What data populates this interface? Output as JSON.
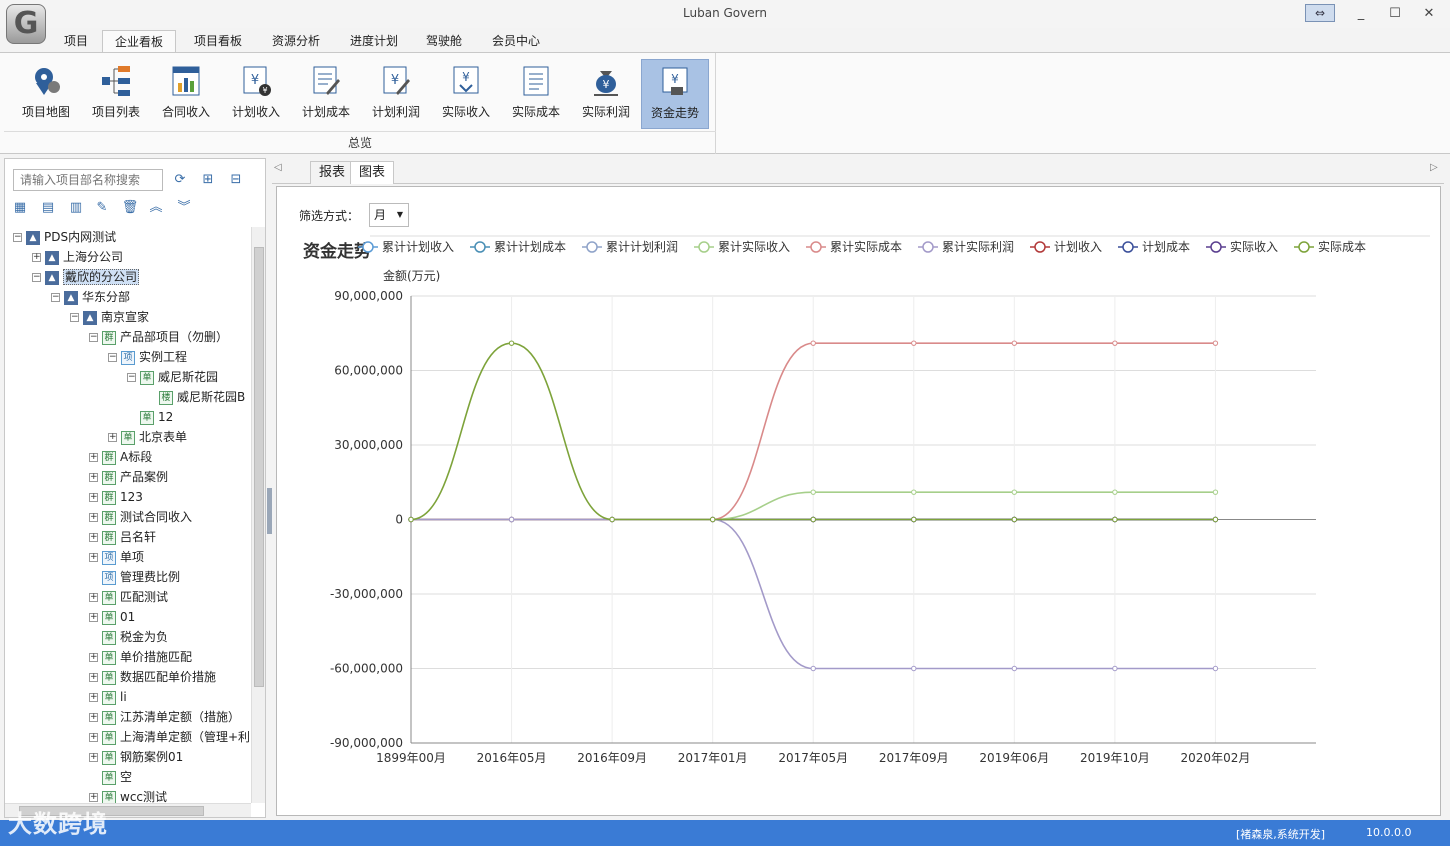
{
  "window": {
    "title": "Luban Govern",
    "logo_glyph": "G",
    "restore_glyph": "⇔",
    "minimize": "_",
    "maximize": "☐",
    "close": "✕"
  },
  "menu": {
    "tabs": [
      "项目",
      "企业看板",
      "项目看板",
      "资源分析",
      "进度计划",
      "驾驶舱",
      "会员中心"
    ],
    "active": "企业看板"
  },
  "ribbon": {
    "buttons": [
      "项目地图",
      "项目列表",
      "合同收入",
      "计划收入",
      "计划成本",
      "计划利润",
      "实际收入",
      "实际成本",
      "实际利润",
      "资金走势"
    ],
    "active": "资金走势",
    "group_label": "总览"
  },
  "sidebar": {
    "search_placeholder": "请输入项目部名称搜索",
    "tree": [
      {
        "label": "PDS内网测试",
        "level": 0,
        "exp": "−",
        "icon": "org"
      },
      {
        "label": "上海分公司",
        "level": 1,
        "exp": "+",
        "icon": "org"
      },
      {
        "label": "戴欣的分公司",
        "level": 1,
        "exp": "−",
        "icon": "org",
        "selected": true
      },
      {
        "label": "华东分部",
        "level": 2,
        "exp": "−",
        "icon": "org"
      },
      {
        "label": "南京宣家",
        "level": 3,
        "exp": "−",
        "icon": "org"
      },
      {
        "label": "产品部项目（勿删）",
        "level": 4,
        "exp": "−",
        "icon": "群"
      },
      {
        "label": "实例工程",
        "level": 5,
        "exp": "−",
        "icon": "项"
      },
      {
        "label": "威尼斯花园",
        "level": 6,
        "exp": "−",
        "icon": "单"
      },
      {
        "label": "威尼斯花园B",
        "level": 7,
        "exp": "",
        "icon": "楼"
      },
      {
        "label": "12",
        "level": 6,
        "exp": "",
        "icon": "单"
      },
      {
        "label": "北京表单",
        "level": 5,
        "exp": "+",
        "icon": "单"
      },
      {
        "label": "A标段",
        "level": 4,
        "exp": "+",
        "icon": "群"
      },
      {
        "label": "产品案例",
        "level": 4,
        "exp": "+",
        "icon": "群"
      },
      {
        "label": "123",
        "level": 4,
        "exp": "+",
        "icon": "群"
      },
      {
        "label": "测试合同收入",
        "level": 4,
        "exp": "+",
        "icon": "群"
      },
      {
        "label": "吕名轩",
        "level": 4,
        "exp": "+",
        "icon": "群"
      },
      {
        "label": "单项",
        "level": 4,
        "exp": "+",
        "icon": "项"
      },
      {
        "label": "管理费比例",
        "level": 4,
        "exp": "",
        "icon": "项"
      },
      {
        "label": "匹配测试",
        "level": 4,
        "exp": "+",
        "icon": "单"
      },
      {
        "label": "01",
        "level": 4,
        "exp": "+",
        "icon": "单"
      },
      {
        "label": "税金为负",
        "level": 4,
        "exp": "",
        "icon": "单"
      },
      {
        "label": "单价措施匹配",
        "level": 4,
        "exp": "+",
        "icon": "单"
      },
      {
        "label": "数据匹配单价措施",
        "level": 4,
        "exp": "+",
        "icon": "单"
      },
      {
        "label": "li",
        "level": 4,
        "exp": "+",
        "icon": "单"
      },
      {
        "label": "江苏清单定额（措施）",
        "level": 4,
        "exp": "+",
        "icon": "单"
      },
      {
        "label": "上海清单定额（管理+利",
        "level": 4,
        "exp": "+",
        "icon": "单"
      },
      {
        "label": "钢筋案例01",
        "level": 4,
        "exp": "+",
        "icon": "单"
      },
      {
        "label": "空",
        "level": 4,
        "exp": "",
        "icon": "单"
      },
      {
        "label": "wcc测试",
        "level": 4,
        "exp": "+",
        "icon": "单"
      }
    ]
  },
  "doc_tabs": [
    "报表",
    "图表"
  ],
  "active_doc_tab": "图表",
  "filter": {
    "label": "筛选方式：",
    "value": "月"
  },
  "chart_data": {
    "type": "line",
    "title": "资金走势",
    "ylabel": "金额(万元)",
    "categories": [
      "1899年00月",
      "2016年05月",
      "2016年09月",
      "2017年01月",
      "2017年05月",
      "2017年09月",
      "2019年06月",
      "2019年10月",
      "2020年02月"
    ],
    "ylim": [
      -90000000,
      90000000
    ],
    "yticks": [
      "90,000,000",
      "60,000,000",
      "30,000,000",
      "0",
      "-30,000,000",
      "-60,000,000",
      "-90,000,000"
    ],
    "ytick_values": [
      90000000,
      60000000,
      30000000,
      0,
      -30000000,
      -60000000,
      -90000000
    ],
    "legend_position": "top",
    "series": [
      {
        "name": "累计计划收入",
        "color": "#5b9bd5",
        "values": [
          0,
          0,
          0,
          0,
          0,
          0,
          0,
          0,
          0
        ]
      },
      {
        "name": "累计计划成本",
        "color": "#4a8fb5",
        "values": [
          0,
          0,
          0,
          0,
          0,
          0,
          0,
          0,
          0
        ]
      },
      {
        "name": "累计计划利润",
        "color": "#8fa3c9",
        "values": [
          0,
          0,
          0,
          0,
          0,
          0,
          0,
          0,
          0
        ]
      },
      {
        "name": "累计实际收入",
        "color": "#a6cf8a",
        "values": [
          0,
          0,
          0,
          0,
          11000000,
          11000000,
          11000000,
          11000000,
          11000000
        ]
      },
      {
        "name": "累计实际成本",
        "color": "#d98a8a",
        "values": [
          0,
          0,
          0,
          0,
          71000000,
          71000000,
          71000000,
          71000000,
          71000000
        ]
      },
      {
        "name": "累计实际利润",
        "color": "#a39ac9",
        "values": [
          0,
          0,
          0,
          0,
          -60000000,
          -60000000,
          -60000000,
          -60000000,
          -60000000
        ]
      },
      {
        "name": "计划收入",
        "color": "#b23a3a",
        "values": [
          0,
          0,
          0,
          0,
          0,
          0,
          0,
          0,
          0
        ]
      },
      {
        "name": "计划成本",
        "color": "#3a4f9a",
        "values": [
          0,
          0,
          0,
          0,
          0,
          0,
          0,
          0,
          0
        ]
      },
      {
        "name": "实际收入",
        "color": "#5a3e8f",
        "values": [
          0,
          0,
          0,
          0,
          0,
          0,
          0,
          0,
          0
        ]
      },
      {
        "name": "实际成本",
        "color": "#7da33a",
        "values": [
          0,
          71000000,
          0,
          0,
          0,
          0,
          0,
          0,
          0
        ]
      }
    ]
  },
  "status": {
    "user": "[褚森泉,系统开发]",
    "version": "10.0.0.0"
  },
  "watermark": "大数跨境"
}
